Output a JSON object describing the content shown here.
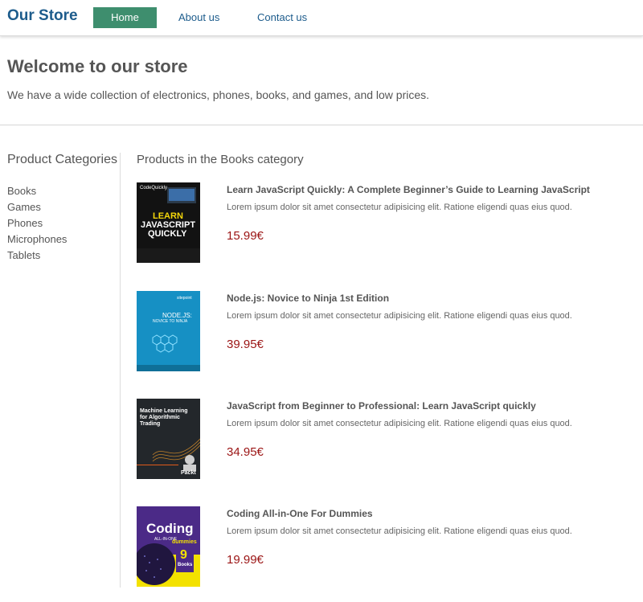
{
  "header": {
    "brand": "Our Store",
    "nav": [
      {
        "label": "Home",
        "active": true
      },
      {
        "label": "About us"
      },
      {
        "label": "Contact us"
      }
    ]
  },
  "welcome": {
    "title": "Welcome to our store",
    "text": "We have a wide collection of electronics, phones, books, and games, and low prices."
  },
  "sidebar": {
    "title": "Product Categories",
    "categories": [
      "Books",
      "Games",
      "Phones",
      "Microphones",
      "Tablets"
    ]
  },
  "products_section": {
    "title": "Products in the Books category",
    "items": [
      {
        "title": "Learn JavaScript Quickly: A Complete Beginner’s Guide to Learning JavaScript",
        "description": "Lorem ipsum dolor sit amet consectetur adipisicing elit. Ratione eligendi quas eius quod.",
        "price": "15.99€",
        "cover": {
          "top": "CodeQuickly",
          "main1": "LEARN",
          "main2": "JAVASCRIPT",
          "main3": "QUICKLY"
        }
      },
      {
        "title": "Node.js: Novice to Ninja 1st Edition",
        "description": "Lorem ipsum dolor sit amet consectetur adipisicing elit. Ratione eligendi quas eius quod.",
        "price": "39.95€",
        "cover": {
          "top": "sitepoint",
          "main1": "NODE.JS:",
          "main2": "NOVICE TO NINJA"
        }
      },
      {
        "title": "JavaScript from Beginner to Professional: Learn JavaScript quickly",
        "description": "Lorem ipsum dolor sit amet consectetur adipisicing elit. Ratione eligendi quas eius quod.",
        "price": "34.95€",
        "cover": {
          "main1": "Machine Learning",
          "main2": "for Algorithmic",
          "main3": "Trading",
          "bottom": "Packt"
        }
      },
      {
        "title": "Coding All-in-One For Dummies",
        "description": "Lorem ipsum dolor sit amet consectetur adipisicing elit. Ratione eligendi quas eius quod.",
        "price": "19.99€",
        "cover": {
          "main1": "Coding",
          "main2": "ALL-IN-ONE",
          "badge": "dummies",
          "num": "9",
          "books": "Books"
        }
      }
    ]
  },
  "colors": {
    "brand": "#1d5c8c",
    "nav_active_bg": "#3e8e6e",
    "price": "#9b1414"
  }
}
